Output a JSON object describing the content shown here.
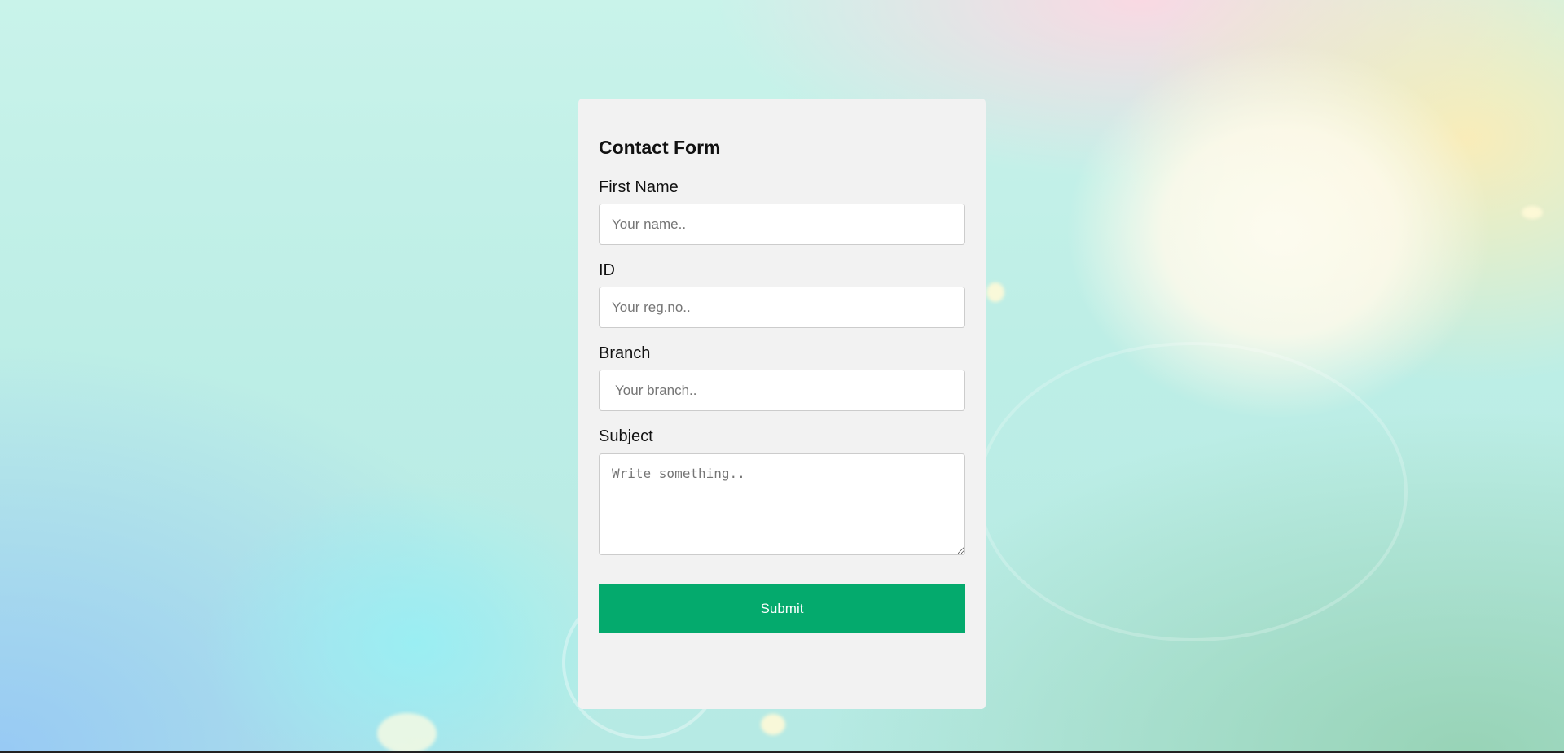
{
  "form": {
    "title": "Contact Form",
    "first_name": {
      "label": "First Name",
      "placeholder": "Your name..",
      "value": ""
    },
    "id": {
      "label": "ID",
      "placeholder": "Your reg.no..",
      "value": ""
    },
    "branch": {
      "label": "Branch",
      "placeholder": "Your branch..",
      "value": ""
    },
    "subject": {
      "label": "Subject",
      "placeholder": "Write something..",
      "value": ""
    },
    "submit_label": "Submit"
  },
  "colors": {
    "accent": "#04aa6d",
    "card_background": "#f2f2f2",
    "field_border": "#cccccc"
  },
  "icons": {
    "textarea_resize": "resize-handle-icon"
  }
}
